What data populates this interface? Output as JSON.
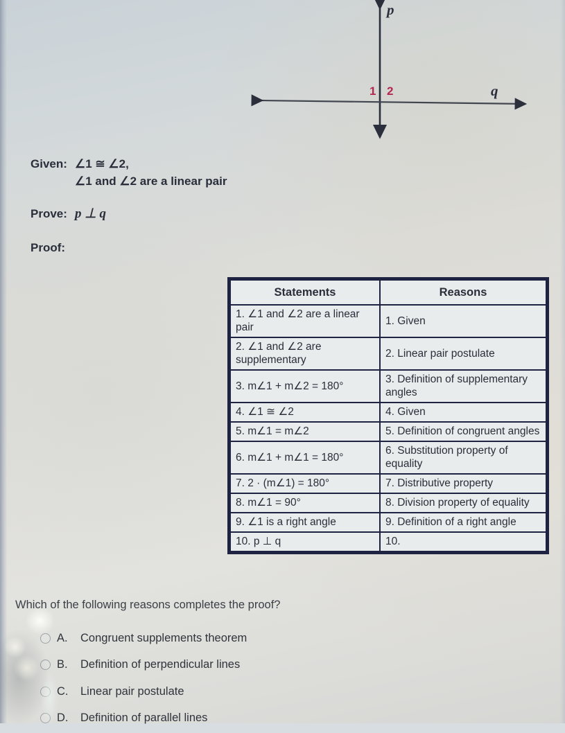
{
  "diagram": {
    "line_vertical_label": "p",
    "line_horizontal_label": "q",
    "angle_label_1": "1",
    "angle_label_2": "2",
    "label_color": "#b5264f",
    "line_color": "#2b2f3c"
  },
  "given": {
    "label": "Given:",
    "line1": "∠1 ≅ ∠2,",
    "line2": "∠1 and ∠2 are a linear pair"
  },
  "prove": {
    "label": "Prove:",
    "value": "p ⊥ q"
  },
  "proof": {
    "label": "Proof:"
  },
  "table": {
    "headers": [
      "Statements",
      "Reasons"
    ],
    "rows": [
      {
        "statement": "1. ∠1 and ∠2 are a linear pair",
        "reason": "1. Given",
        "blank": false
      },
      {
        "statement": "2. ∠1 and ∠2 are supplementary",
        "reason": "2. Linear pair postulate",
        "blank": false
      },
      {
        "statement": "3. m∠1 + m∠2 = 180°",
        "reason": "3. Definition of supplementary angles",
        "blank": false
      },
      {
        "statement": "4. ∠1 ≅ ∠2",
        "reason": "4. Given",
        "blank": false
      },
      {
        "statement": "5. m∠1 = m∠2",
        "reason": "5. Definition of congruent angles",
        "blank": false
      },
      {
        "statement": "6. m∠1 + m∠1 = 180°",
        "reason": "6. Substitution property of equality",
        "blank": false
      },
      {
        "statement": "7. 2 · (m∠1) = 180°",
        "reason": "7. Distributive property",
        "blank": false
      },
      {
        "statement": "8. m∠1 = 90°",
        "reason": "8. Division property of equality",
        "blank": false
      },
      {
        "statement": "9. ∠1 is a right angle",
        "reason": "9. Definition of a right angle",
        "blank": false
      },
      {
        "statement": "10. p ⊥ q",
        "reason": "10.",
        "blank": true
      }
    ]
  },
  "question": {
    "text": "Which of the following reasons completes the proof?"
  },
  "choices": [
    {
      "letter": "A.",
      "text": "Congruent supplements theorem",
      "selected": false
    },
    {
      "letter": "B.",
      "text": "Definition of perpendicular lines",
      "selected": false
    },
    {
      "letter": "C.",
      "text": "Linear pair postulate",
      "selected": false
    },
    {
      "letter": "D.",
      "text": "Definition of parallel lines",
      "selected": false
    }
  ]
}
